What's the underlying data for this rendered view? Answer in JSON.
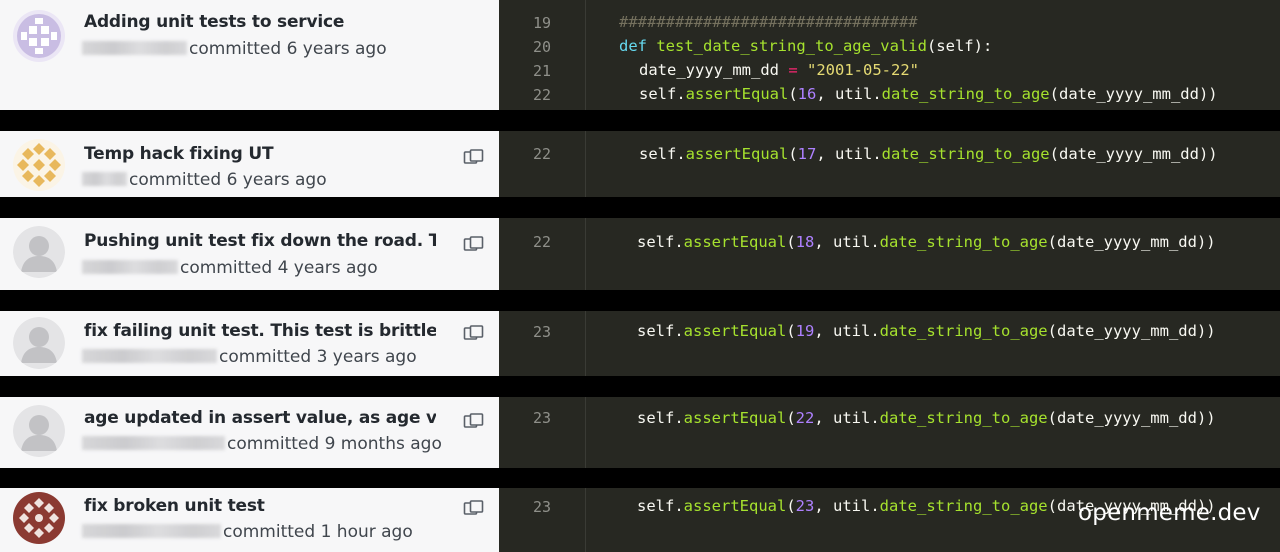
{
  "commits": [
    {
      "title": "Adding unit tests to service",
      "meta": "committed 6 years ago",
      "avatar": "purple-identicon"
    },
    {
      "title": "Temp hack fixing UT",
      "meta": "committed 6 years ago",
      "avatar": "gold-identicon"
    },
    {
      "title": "Pushing unit test fix down the road. This t",
      "meta": "committed 4 years ago",
      "avatar": "default-avatar"
    },
    {
      "title": "fix failing unit test. This test is brittle and",
      "meta": "committed 3 years ago",
      "avatar": "default-avatar"
    },
    {
      "title": "age updated in assert value, as age valid",
      "meta": "committed 9 months ago",
      "avatar": "default-avatar"
    },
    {
      "title": "fix broken unit test",
      "meta": "committed 1 hour ago",
      "avatar": "maroon-identicon"
    }
  ],
  "code_block_1": {
    "line_numbers": [
      "19",
      "20",
      "21",
      "22"
    ],
    "comment": "################################",
    "def_keyword": "def",
    "func_name": "test_date_string_to_age_valid",
    "def_params": "(self):",
    "var_name": "date_yyyy_mm_dd",
    "assign_op": "=",
    "date_value": "\"2001-05-22\""
  },
  "assert_code": {
    "prefix": "self.",
    "method": "assertEqual",
    "open": "(",
    "mid": ", util.",
    "call": "date_string_to_age",
    "arg": "(date_yyyy_mm_dd))"
  },
  "asserts": [
    {
      "line": "22",
      "value": "16"
    },
    {
      "line": "22",
      "value": "17"
    },
    {
      "line": "22",
      "value": "18"
    },
    {
      "line": "23",
      "value": "19"
    },
    {
      "line": "23",
      "value": "22"
    },
    {
      "line": "23",
      "value": "23"
    }
  ],
  "icons": {
    "copy": "copy-icon",
    "avatar_default": "person-silhouette-icon"
  },
  "colors": {
    "code_bg": "#272822",
    "panel_bg": "#f7f7f8",
    "keyword": "#66d9ef",
    "function": "#a6e22e",
    "number": "#ae81ff",
    "string": "#e6db74",
    "comment": "#75715e"
  },
  "watermark": "openmeme.dev"
}
